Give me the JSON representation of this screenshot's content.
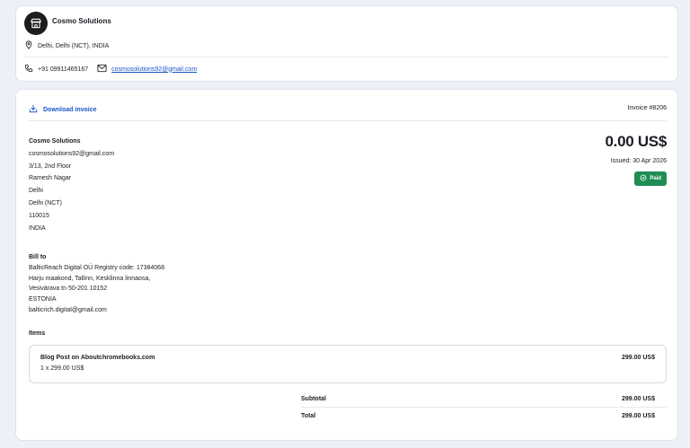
{
  "company": {
    "name": "Cosmo Solutions",
    "location": "Delhi, Delhi (NCT), INDIA",
    "phone": "+91 09911465167",
    "email": "cosmosolutions92@gmail.com"
  },
  "invoice": {
    "download_label": "Download invoice",
    "number": "Invoice #8206",
    "amount": "0.00 US$",
    "issued": "Issued: 30 Apr 2026",
    "status": "Paid",
    "status_color": "#1f8d55",
    "link_color": "#1a56c8"
  },
  "seller": {
    "name": "Cosmo Solutions",
    "lines": [
      "cosmosolutions92@gmail.com",
      "3/13, 2nd Floor",
      "Ramesh Nagar",
      "Delhi",
      "Delhi (NCT)",
      "110015",
      "INDIA"
    ]
  },
  "bill_to": {
    "label": "Bill to",
    "lines": [
      "BalticReach Digital OÜ Registry code: 17384068",
      "Harju maakond, Tallinn, Kesklinna linnaosa,",
      "Vesivärava tn 50-201 10152",
      "ESTONIA",
      "balticrich.digital@gmail.com"
    ]
  },
  "items": {
    "label": "Items",
    "list": [
      {
        "title": "Blog Post on Aboutchromebooks.com",
        "qty": "1 x 299.00 US$",
        "price": "299.00 US$"
      }
    ]
  },
  "totals": {
    "subtotal_label": "Subtotal",
    "subtotal": "299.00 US$",
    "total_label": "Total",
    "total": "299.00 US$"
  },
  "icons": [
    "store-icon",
    "location-pin-icon",
    "phone-icon",
    "mail-icon",
    "download-icon",
    "check-circle-icon"
  ]
}
